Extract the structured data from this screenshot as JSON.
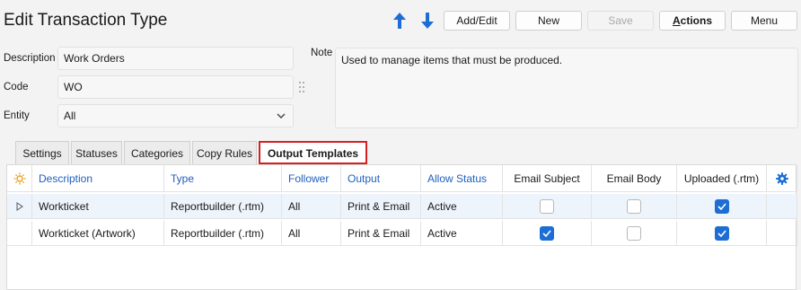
{
  "window": {
    "title": "Edit Transaction Type"
  },
  "toolbar": {
    "up_icon": "arrow-up-icon",
    "down_icon": "arrow-down-icon",
    "add_edit": "Add/Edit",
    "new": "New",
    "save": "Save",
    "actions_first": "A",
    "actions_rest": "ctions",
    "menu": "Menu"
  },
  "form": {
    "description_label": "Description",
    "description_value": "Work Orders",
    "code_label": "Code",
    "code_value": "WO",
    "entity_label": "Entity",
    "entity_value": "All",
    "note_label": "Note",
    "note_value": "Used to manage items that must be produced."
  },
  "tabs": [
    "Settings",
    "Statuses",
    "Categories",
    "Copy Rules",
    "Output Templates"
  ],
  "active_tab": "Output Templates",
  "grid": {
    "columns": [
      "Description",
      "Type",
      "Follower",
      "Output",
      "Allow Status",
      "Email Subject",
      "Email Body",
      "Uploaded (.rtm)"
    ],
    "rows": [
      {
        "description": "Workticket",
        "type": "Reportbuilder (.rtm)",
        "follower": "All",
        "output": "Print & Email",
        "allow_status": "Active",
        "email_subject": false,
        "email_body": false,
        "uploaded": true
      },
      {
        "description": "Workticket (Artwork)",
        "type": "Reportbuilder (.rtm)",
        "follower": "All",
        "output": "Print & Email",
        "allow_status": "Active",
        "email_subject": true,
        "email_body": false,
        "uploaded": true
      }
    ]
  },
  "colors": {
    "accent": "#1d6ed4",
    "header_link": "#1f5fbf",
    "tab_highlight": "#d62020"
  }
}
